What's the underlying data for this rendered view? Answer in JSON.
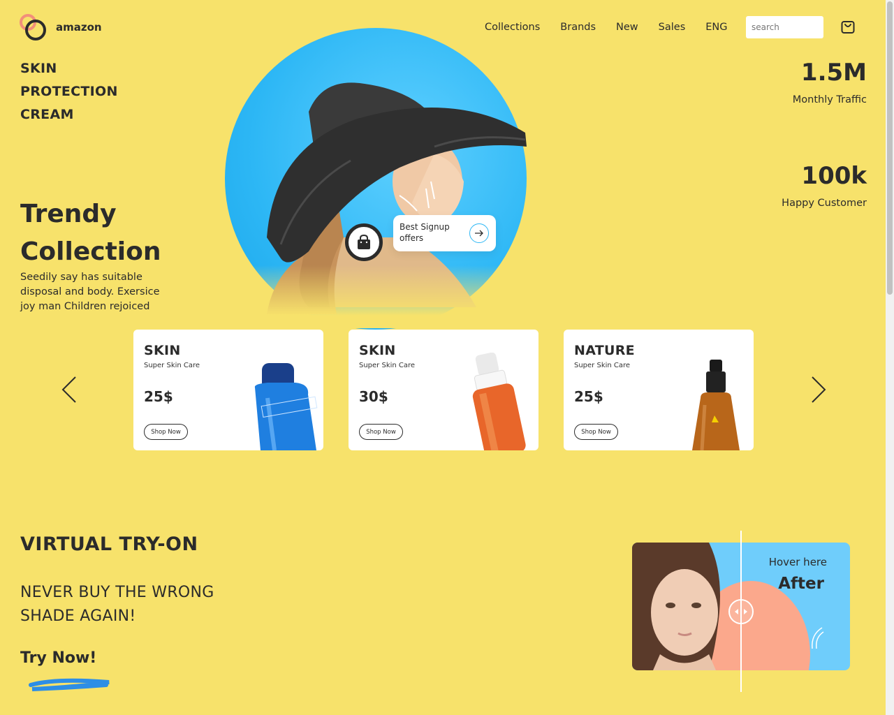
{
  "brand": {
    "name": "amazon"
  },
  "nav": {
    "items": [
      "Collections",
      "Brands",
      "New",
      "Sales",
      "ENG"
    ],
    "search_placeholder": "search"
  },
  "hero": {
    "tagline": [
      "SKIN",
      "PROTECTION",
      "CREAM"
    ],
    "title": [
      "Trendy",
      "Collection"
    ],
    "description": "Seedily say has suitable disposal and body. Exersice joy man Children rejoiced",
    "signup_card": "Best Signup offers"
  },
  "stats": [
    {
      "value": "1.5M",
      "label": "Monthly Traffic"
    },
    {
      "value": "100k",
      "label": "Happy Customer"
    }
  ],
  "products": [
    {
      "name": "SKIN",
      "subtitle": "Super Skin Care",
      "price": "25$",
      "button": "Shop Now",
      "bottle_color": "#1f7fe0",
      "bottle_text": "BRAND COSMETICS"
    },
    {
      "name": "SKIN",
      "subtitle": "Super Skin Care",
      "price": "30$",
      "button": "Shop Now",
      "bottle_color": "#e8662a",
      "bottle_text": ""
    },
    {
      "name": "NATURE",
      "subtitle": "Super Skin Care",
      "price": "25$",
      "button": "Shop Now",
      "bottle_color": "#c06a1a",
      "bottle_text": ""
    }
  ],
  "virtual_tryon": {
    "title": "VIRTUAL TRY-ON",
    "subtitle": "NEVER BUY THE WRONG SHADE AGAIN!",
    "cta": "Try Now!",
    "compare_hint": "Hover here",
    "compare_after": "After"
  },
  "colors": {
    "background": "#f7e26b",
    "accent_blue": "#2db7f5",
    "peach": "#fba88c",
    "text": "#2b2b2b"
  },
  "icons": [
    "cart-icon",
    "shopping-bag-icon",
    "arrow-right-icon",
    "chevron-left-icon",
    "chevron-right-icon",
    "compare-arrows-icon"
  ]
}
